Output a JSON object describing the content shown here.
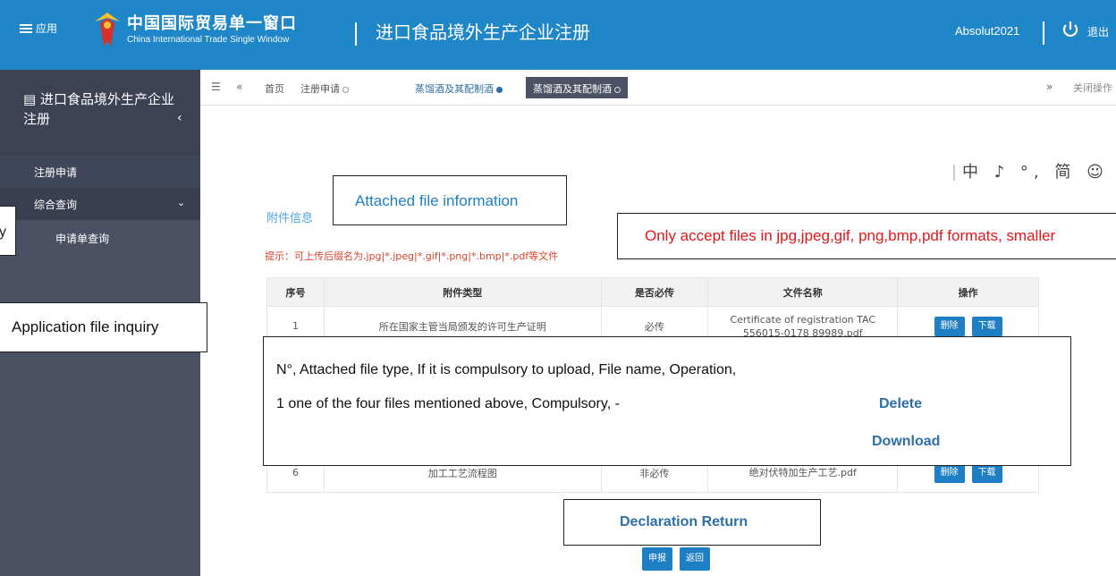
{
  "header": {
    "menu_label": "应用",
    "brand_cn": "中国国际贸易单一窗口",
    "brand_en": "China International Trade Single Window",
    "page_title": "进口食品境外生产企业注册",
    "user_name": "Absolut2021",
    "logout_label": "退出"
  },
  "sidebar": {
    "title": "进口食品境外生产企业注册",
    "collapse": "‹",
    "items": [
      {
        "label": "注册申请"
      },
      {
        "label": "综合查询"
      },
      {
        "label": "申请单查询"
      }
    ]
  },
  "tabs": [
    {
      "label": "首页"
    },
    {
      "label": "注册申请"
    },
    {
      "label": "蒸馏酒及其配制酒"
    },
    {
      "label": "蒸馏酒及其配制酒"
    }
  ],
  "tab_right": {
    "next": "»",
    "close_all": "关闭操作"
  },
  "input_tools": "中 ♪ °, 简 ☺",
  "attachment": {
    "section_label": "附件信息",
    "hint": "提示：可上传后缀名为.jpg|*.jpeg|*.gif|*.png|*.bmp|*.pdf等文件"
  },
  "table": {
    "headers": [
      "序号",
      "附件类型",
      "是否必传",
      "文件名称",
      "操作"
    ],
    "rows": [
      {
        "no": "1",
        "type": "所在国家主管当局颁发的许可生产证明",
        "required": "必传",
        "file": "Certificate of registration TAC 556015-0178 89989.pdf"
      },
      {
        "no": "6",
        "type": "加工工艺流程图",
        "required": "非必传",
        "file": "绝对伏特加生产工艺.pdf"
      }
    ],
    "delete_label": "删除",
    "download_label": "下载"
  },
  "actions": {
    "declare_label": "申报",
    "return_label": "返回"
  },
  "annotations": {
    "attached": "Attached file information",
    "only_accept": "Only accept files in jpg,jpeg,gif, png,bmp,pdf formats, smaller",
    "left_y": "y",
    "app_file": "Application file inquiry",
    "big_line1": "N°, Attached file type,          If it is compulsory to upload, File name,               Operation,",
    "big_line2": "1    one of the four files mentioned above, Compulsory,             -",
    "big_delete": "Delete",
    "big_download": "Download",
    "decl_return": "Declaration Return"
  },
  "colors": {
    "header": "#1f86c8",
    "sidebar": "#4b5163",
    "button": "#1f7fc4",
    "hint": "#d9432a",
    "callout_red": "#e3171c"
  }
}
